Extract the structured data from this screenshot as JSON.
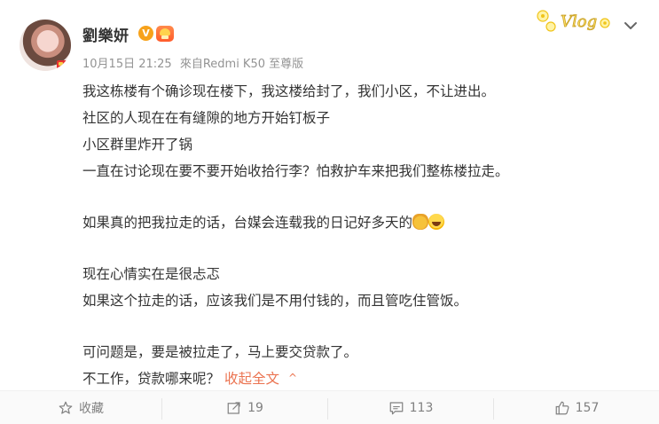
{
  "user": {
    "name": "劉樂妍",
    "verified_mark": "V"
  },
  "post": {
    "date": "10月15日 21:25",
    "source": "來自Redmi K50 至尊版",
    "lines": [
      "我这栋楼有个确诊现在楼下，我这楼给封了，我们小区，不让进出。",
      "社区的人现在在有缝隙的地方开始钉板子",
      "小区群里炸开了锅",
      "一直在讨论现在要不要开始收拾行李？怕救护车来把我们整栋楼拉走。",
      "",
      "如果真的把我拉走的话，台媒会连载我的日记好多天的",
      "",
      "现在心情实在是很忐忑",
      "如果这个拉走的话，应该我们是不用付钱的，而且管吃住管饭。",
      "",
      "可问题是，要是被拉走了，马上要交贷款了。",
      "不工作，贷款哪来呢？"
    ],
    "collapse_label": "收起全文",
    "caret": "^"
  },
  "badge": {
    "vlog_text": "Vlog"
  },
  "actions": {
    "favorite_label": "收藏",
    "repost_count": "19",
    "comment_count": "113",
    "like_count": "157"
  },
  "colors": {
    "accent": "#eb7350",
    "meta": "#939393",
    "text": "#333333",
    "verified": "#f7a21b"
  }
}
